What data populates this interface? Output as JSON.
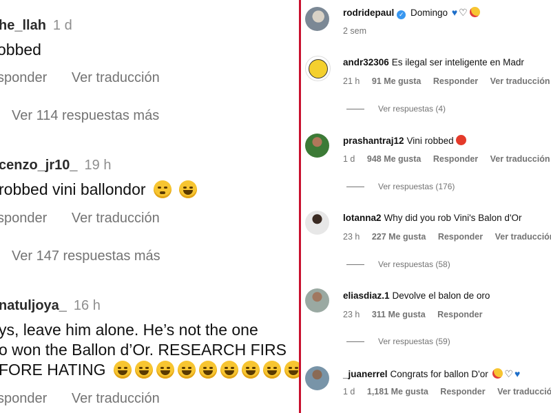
{
  "left_panel": {
    "comments": [
      {
        "username": "he_llah",
        "time": "1 d",
        "text": "obbed",
        "emojis": [],
        "reply": "sponder",
        "translate": "Ver traducción",
        "more_replies": "Ver 114 respuestas más"
      },
      {
        "username": "cenzo_jr10_",
        "time": "19 h",
        "text": "robbed vini ballondor",
        "emojis": [
          "sleepy-emoji",
          "laughing-emoji"
        ],
        "reply": "sponder",
        "translate": "Ver traducción",
        "more_replies": "Ver 147 respuestas más"
      },
      {
        "username": "natuljoya_",
        "time": "16 h",
        "lines": [
          "ys, leave him alone. He’s not the one",
          "o won the Ballon d’Or. RESEARCH FIRS",
          "FORE HATING"
        ],
        "emoji_count": 9,
        "reply": "sponder",
        "translate": "Ver traducción"
      }
    ]
  },
  "right_panel": {
    "post": {
      "username": "rodridepaul",
      "caption": "Domingo",
      "time": "2 sem",
      "icons": [
        "verified-badge",
        "blue-heart",
        "white-heart",
        "heart-eyes-emoji"
      ]
    },
    "comments": [
      {
        "username": "andr32306",
        "text": "Es ilegal ser inteligente en Madr",
        "time": "21 h",
        "likes": "91 Me gusta",
        "reply": "Responder",
        "translate": "Ver traducción",
        "view_replies": "Ver respuestas (4)"
      },
      {
        "username": "prashantraj12",
        "text": "Vini robbed",
        "time": "1 d",
        "likes": "948 Me gusta",
        "reply": "Responder",
        "translate": "Ver traducción",
        "view_replies": "Ver respuestas (176)"
      },
      {
        "username": "lotanna2",
        "text": "Why did you rob Vini's Balon d'Or",
        "time": "23 h",
        "likes": "227 Me gusta",
        "reply": "Responder",
        "translate": "Ver traducción",
        "view_replies": "Ver respuestas (58)"
      },
      {
        "username": "eliasdiaz.1",
        "text": "Devolve el balon de oro",
        "time": "23 h",
        "likes": "311 Me gusta",
        "reply": "Responder",
        "translate": "",
        "view_replies": "Ver respuestas (59)"
      },
      {
        "username": "_juanerrel",
        "text": "Congrats for ballon D'or",
        "time": "1 d",
        "likes": "1,181 Me gusta",
        "reply": "Responder",
        "translate": "Ver traducción",
        "view_replies": ""
      }
    ]
  },
  "colors": {
    "divider": "#c8102e",
    "meta_gray": "#737373",
    "verified_blue": "#3897f0"
  }
}
